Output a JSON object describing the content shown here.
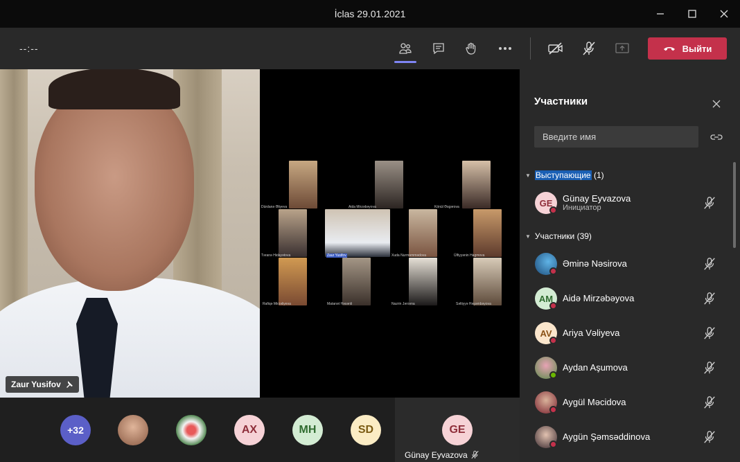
{
  "window": {
    "title": "İclas 29.01.2021"
  },
  "toolbar": {
    "timer": "--:--",
    "leave_label": "Выйти"
  },
  "stage": {
    "speaker_name": "Zaur Yusifov",
    "grid_labels": [
      "Dürdanə Əliyeva",
      "Aida Mirzəbəyova",
      "Könül Əsgərova",
      "Təranə Hidayətova",
      "Zaur Yusifov",
      "Xuda Nurməmmədova",
      "Ülfiyyənin Hagmova",
      "Rafiqə Mirzəliyeva",
      "Matanət Həsənli",
      "Nazrin Jərovna",
      "Səltiyyə Həşəmbəyova"
    ]
  },
  "bottom_bar": {
    "overflow_count": "+32",
    "avatars": [
      "AX",
      "MH",
      "SD"
    ],
    "self": {
      "initials": "GE",
      "name": "Günay Eyvazova"
    }
  },
  "panel": {
    "title": "Участники",
    "search_placeholder": "Введите имя",
    "presenters_section": "Выступающие",
    "presenters_count": "(1)",
    "attendees_section": "Участники (39)",
    "presenter": {
      "initials": "GE",
      "name": "Günay Eyvazova",
      "role": "Инициатор"
    },
    "participants": [
      {
        "initials": "",
        "name": "Əminə Nəsirova"
      },
      {
        "initials": "AM",
        "name": "Aidə Mirzəbəyova"
      },
      {
        "initials": "AV",
        "name": "Ariya Vəliyeva"
      },
      {
        "initials": "",
        "name": "Aydan Aşumova"
      },
      {
        "initials": "",
        "name": "Aygül Məcidova"
      },
      {
        "initials": "",
        "name": "Aygün Şəmsəddinova"
      }
    ]
  },
  "colors": {
    "accent": "#7f85f5",
    "leave": "#c4314b",
    "muted_dot": "#c4314b",
    "available_dot": "#6bb700"
  }
}
